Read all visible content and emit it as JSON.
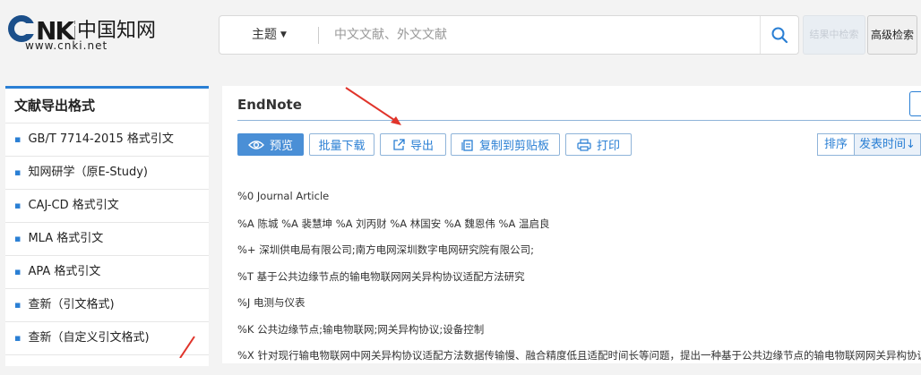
{
  "header": {
    "logo": {
      "text": "CNKi",
      "cn": "中国知网",
      "url": "www.cnki.net"
    },
    "search": {
      "field": "主题",
      "placeholder": "中文文献、外文文献"
    },
    "within_label": "结果中检索",
    "advanced_label": "高级检索"
  },
  "sidebar": {
    "title": "文献导出格式",
    "items": [
      "GB/T 7714-2015 格式引文",
      "知网研学（原E-Study)",
      "CAJ-CD 格式引文",
      "MLA 格式引文",
      "APA 格式引文",
      "查新（引文格式)",
      "查新（自定义引文格式)"
    ]
  },
  "main": {
    "title": "EndNote",
    "toolbar": {
      "preview": "预览",
      "batch_download": "批量下载",
      "export": "导出",
      "copy": "复制到剪贴板",
      "print": "打印",
      "sort": "排序",
      "sort_by": "发表时间"
    },
    "lines": [
      "%0 Journal Article",
      "%A 陈城 %A 裴慧坤 %A 刘丙财 %A 林国安 %A 魏恩伟 %A 温启良",
      "%+ 深圳供电局有限公司;南方电网深圳数字电网研究院有限公司;",
      "%T 基于公共边缘节点的输电物联网网关异构协议适配方法研究",
      "%J 电测与仪表",
      "%K 公共边缘节点;输电物联网;网关异构协议;设备控制",
      "%X 针对现行输电物联网中网关异构协议适配方法数据传输慢、融合精度低且适配时间长等问题，提出一种基于公共边缘节点的输电物联网网关异构协议适配"
    ]
  },
  "colors": {
    "accent": "#2a7fd4",
    "annotation": "#e0342b"
  }
}
